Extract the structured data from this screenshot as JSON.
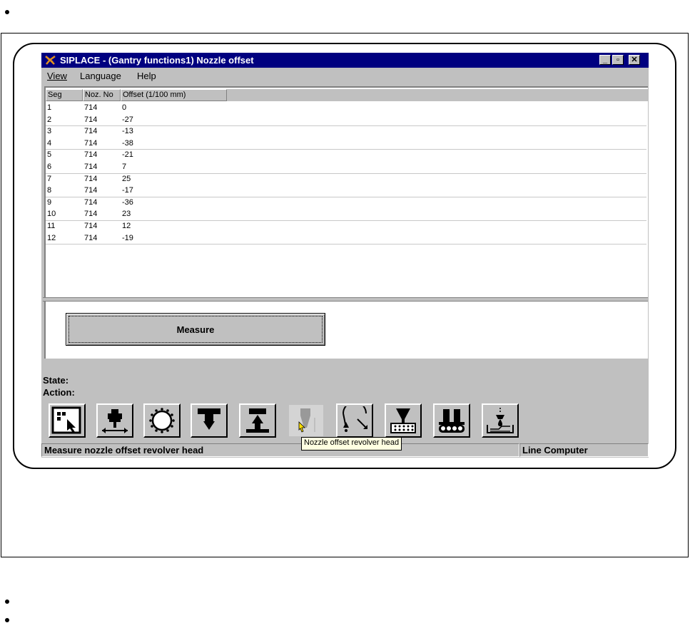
{
  "window": {
    "title": "SIPLACE - (Gantry functions1) Nozzle offset",
    "min_label": "_",
    "max_label": "▫",
    "close_label": "✕"
  },
  "menu": {
    "view": "View",
    "language": "Language",
    "help": "Help"
  },
  "table": {
    "headers": [
      "Seg",
      "Noz. No",
      "Offset (1/100 mm)"
    ],
    "rows": [
      [
        "1",
        "714",
        "0"
      ],
      [
        "2",
        "714",
        "-27"
      ],
      [
        "3",
        "714",
        "-13"
      ],
      [
        "4",
        "714",
        "-38"
      ],
      [
        "5",
        "714",
        "-21"
      ],
      [
        "6",
        "714",
        "7"
      ],
      [
        "7",
        "714",
        "25"
      ],
      [
        "8",
        "714",
        "-17"
      ],
      [
        "9",
        "714",
        "-36"
      ],
      [
        "10",
        "714",
        "23"
      ],
      [
        "11",
        "714",
        "12"
      ],
      [
        "12",
        "714",
        "-19"
      ]
    ]
  },
  "measure_button": "Measure",
  "state_label": "State:",
  "action_label": "Action:",
  "toolbar": {
    "icons": [
      "select-arrow-icon",
      "gantry-move-icon",
      "revolver-head-icon",
      "place-down-icon",
      "pickup-up-icon",
      "nozzle-offset-icon",
      "revolver-rotate-icon",
      "nozzle-tray-icon",
      "conveyor-icon",
      "dip-fluid-icon"
    ],
    "tooltip": "Nozzle offset revolver head"
  },
  "status": {
    "message": "Measure nozzle offset revolver head",
    "mode": "Line Computer"
  },
  "colors": {
    "titlebar": "#000080",
    "face": "#c0c0c0",
    "tooltip": "#ffffe1"
  }
}
